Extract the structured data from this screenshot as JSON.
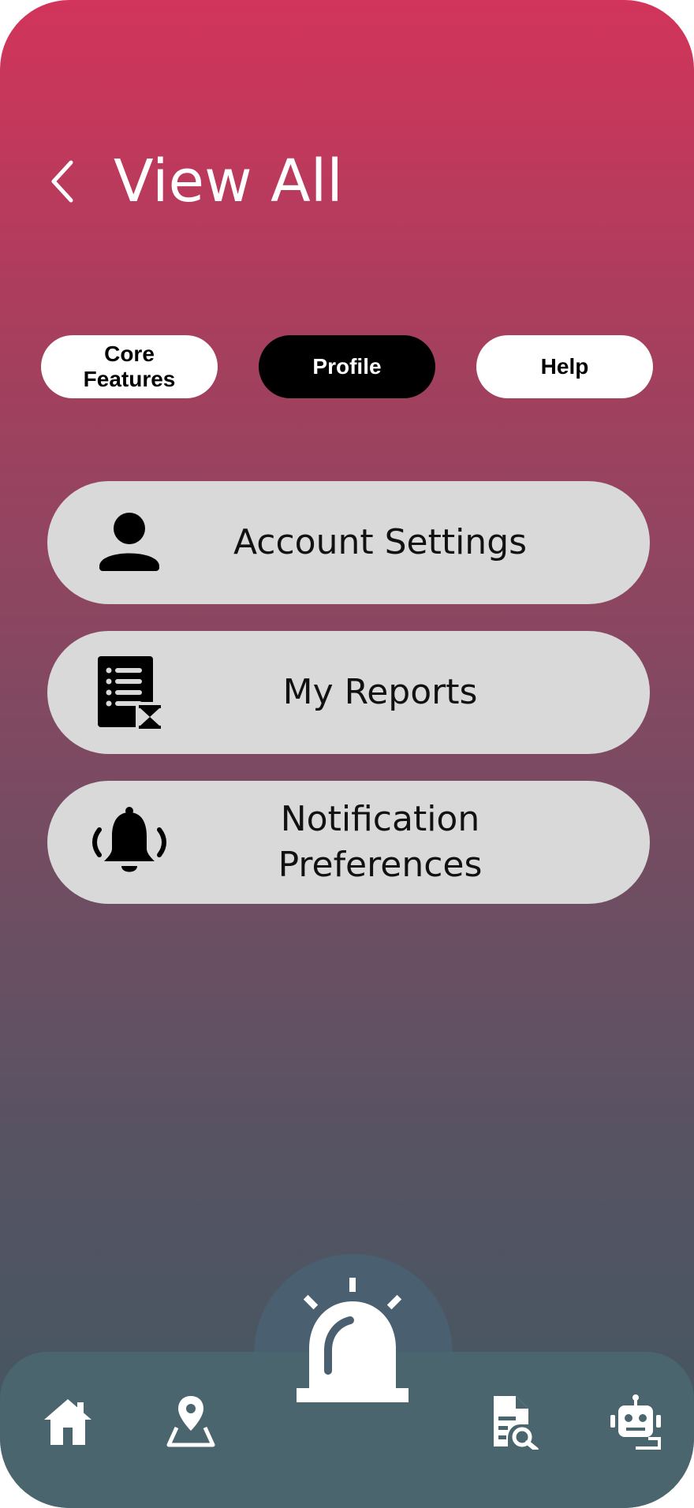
{
  "header": {
    "title": "View All"
  },
  "tabs": [
    {
      "label": "Core Features",
      "active": false
    },
    {
      "label": "Profile",
      "active": true
    },
    {
      "label": "Help",
      "active": false
    }
  ],
  "menu": [
    {
      "label": "Account Settings",
      "icon": "person-icon"
    },
    {
      "label": "My Reports",
      "icon": "report-pending-icon"
    },
    {
      "label": "Notification Preferences",
      "icon": "bell-ringing-icon"
    }
  ],
  "bottom_nav": [
    {
      "icon": "home-icon"
    },
    {
      "icon": "map-pin-icon"
    },
    {
      "icon": "siren-alarm-icon"
    },
    {
      "icon": "document-search-icon"
    },
    {
      "icon": "robot-icon"
    }
  ],
  "colors": {
    "gradient_top": "#d2345a",
    "gradient_bottom": "#3f5862",
    "card_bg": "#d9d9d9",
    "navbar_bg": "#4a656d",
    "alarm_dome_bg": "#4a5f6f",
    "active_tab": "#000000"
  }
}
